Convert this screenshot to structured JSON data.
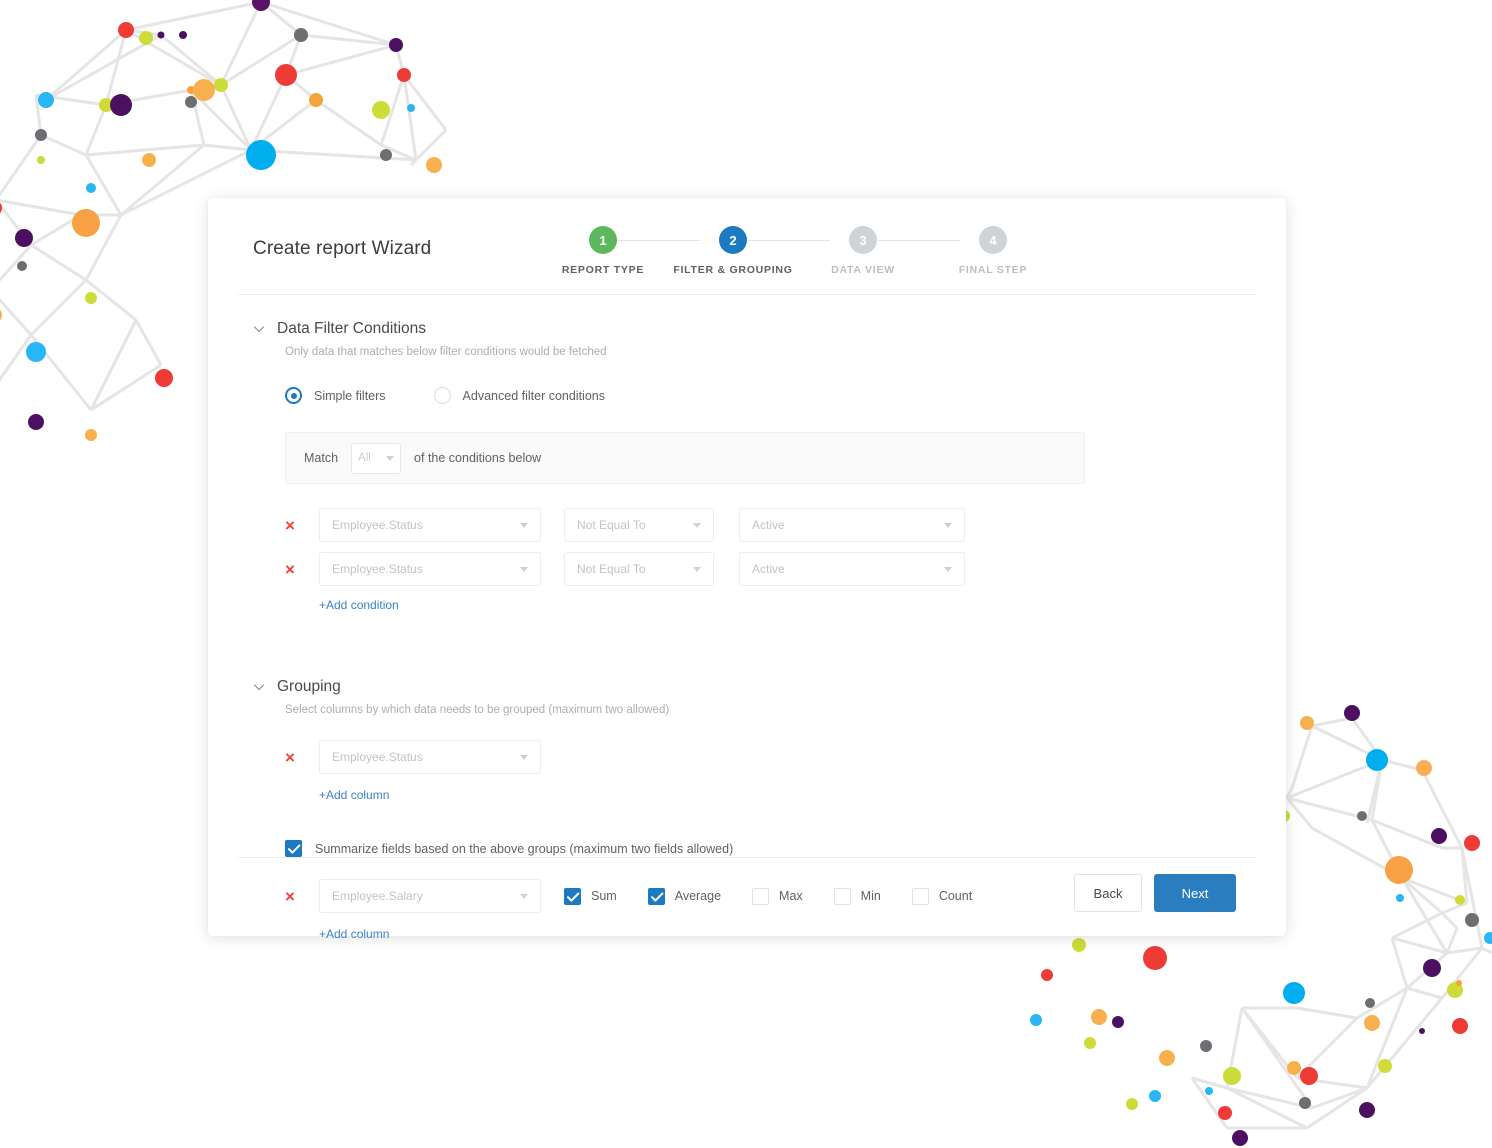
{
  "window": {
    "title": "Create report Wizard"
  },
  "stepper": {
    "steps": [
      {
        "num": "1",
        "label": "REPORT TYPE",
        "state": "done"
      },
      {
        "num": "2",
        "label": "FILTER & GROUPING",
        "state": "active"
      },
      {
        "num": "3",
        "label": "DATA VIEW",
        "state": "todo"
      },
      {
        "num": "4",
        "label": "FINAL STEP",
        "state": "todo"
      }
    ],
    "colors": {
      "done": "#5cb85c",
      "active": "#1b7ac2",
      "todo": "#ced3d8"
    }
  },
  "filter_section": {
    "title": "Data Filter Conditions",
    "subtitle": "Only data that matches below filter conditions would be fetched",
    "mode_options": [
      {
        "label": "Simple filters",
        "selected": true
      },
      {
        "label": "Advanced filter conditions",
        "selected": false
      }
    ],
    "match_prefix": "Match",
    "match_value": "All",
    "match_suffix": "of the conditions below",
    "conditions": [
      {
        "field": "Employee.Status",
        "operator": "Not Equal To",
        "value": "Active",
        "remove": "×"
      },
      {
        "field": "Employee.Status",
        "operator": "Not Equal To",
        "value": "Active",
        "remove": "×"
      }
    ],
    "add_condition_label": "+Add condition"
  },
  "grouping_section": {
    "title": "Grouping",
    "subtitle": "Select columns by which data needs to be grouped (maximum two allowed)",
    "columns": [
      {
        "field": "Employee.Status",
        "remove": "×"
      }
    ],
    "add_column_label": "+Add column",
    "summarize": {
      "label": "Summarize fields based on the above groups (maximum two fields allowed)",
      "checked": true
    },
    "summary_rows": [
      {
        "field": "Employee.Salary",
        "remove": "×",
        "aggregates": [
          {
            "label": "Sum",
            "checked": true
          },
          {
            "label": "Average",
            "checked": true
          },
          {
            "label": "Max",
            "checked": false
          },
          {
            "label": "Min",
            "checked": false
          },
          {
            "label": "Count",
            "checked": false
          }
        ]
      }
    ],
    "add_summary_column_label": "+Add column"
  },
  "footer": {
    "back_label": "Back",
    "next_label": "Next",
    "next_color": "#2a7dbf"
  },
  "theme": {
    "accent_blue": "#1b7ac2",
    "link_blue": "#3a83c9",
    "remove_red": "#ef4136",
    "step_green": "#5cb85c"
  }
}
